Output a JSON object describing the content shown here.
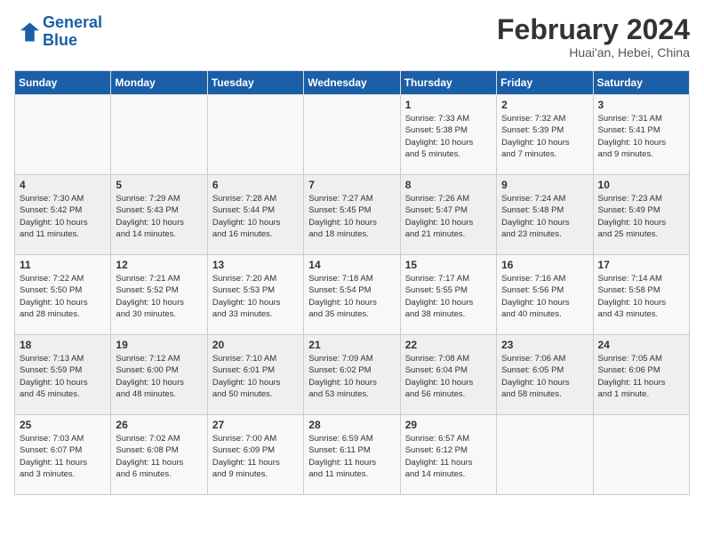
{
  "header": {
    "logo_line1": "General",
    "logo_line2": "Blue",
    "title": "February 2024",
    "subtitle": "Huai'an, Hebei, China"
  },
  "weekdays": [
    "Sunday",
    "Monday",
    "Tuesday",
    "Wednesday",
    "Thursday",
    "Friday",
    "Saturday"
  ],
  "weeks": [
    [
      {
        "day": "",
        "info": ""
      },
      {
        "day": "",
        "info": ""
      },
      {
        "day": "",
        "info": ""
      },
      {
        "day": "",
        "info": ""
      },
      {
        "day": "1",
        "info": "Sunrise: 7:33 AM\nSunset: 5:38 PM\nDaylight: 10 hours\nand 5 minutes."
      },
      {
        "day": "2",
        "info": "Sunrise: 7:32 AM\nSunset: 5:39 PM\nDaylight: 10 hours\nand 7 minutes."
      },
      {
        "day": "3",
        "info": "Sunrise: 7:31 AM\nSunset: 5:41 PM\nDaylight: 10 hours\nand 9 minutes."
      }
    ],
    [
      {
        "day": "4",
        "info": "Sunrise: 7:30 AM\nSunset: 5:42 PM\nDaylight: 10 hours\nand 11 minutes."
      },
      {
        "day": "5",
        "info": "Sunrise: 7:29 AM\nSunset: 5:43 PM\nDaylight: 10 hours\nand 14 minutes."
      },
      {
        "day": "6",
        "info": "Sunrise: 7:28 AM\nSunset: 5:44 PM\nDaylight: 10 hours\nand 16 minutes."
      },
      {
        "day": "7",
        "info": "Sunrise: 7:27 AM\nSunset: 5:45 PM\nDaylight: 10 hours\nand 18 minutes."
      },
      {
        "day": "8",
        "info": "Sunrise: 7:26 AM\nSunset: 5:47 PM\nDaylight: 10 hours\nand 21 minutes."
      },
      {
        "day": "9",
        "info": "Sunrise: 7:24 AM\nSunset: 5:48 PM\nDaylight: 10 hours\nand 23 minutes."
      },
      {
        "day": "10",
        "info": "Sunrise: 7:23 AM\nSunset: 5:49 PM\nDaylight: 10 hours\nand 25 minutes."
      }
    ],
    [
      {
        "day": "11",
        "info": "Sunrise: 7:22 AM\nSunset: 5:50 PM\nDaylight: 10 hours\nand 28 minutes."
      },
      {
        "day": "12",
        "info": "Sunrise: 7:21 AM\nSunset: 5:52 PM\nDaylight: 10 hours\nand 30 minutes."
      },
      {
        "day": "13",
        "info": "Sunrise: 7:20 AM\nSunset: 5:53 PM\nDaylight: 10 hours\nand 33 minutes."
      },
      {
        "day": "14",
        "info": "Sunrise: 7:18 AM\nSunset: 5:54 PM\nDaylight: 10 hours\nand 35 minutes."
      },
      {
        "day": "15",
        "info": "Sunrise: 7:17 AM\nSunset: 5:55 PM\nDaylight: 10 hours\nand 38 minutes."
      },
      {
        "day": "16",
        "info": "Sunrise: 7:16 AM\nSunset: 5:56 PM\nDaylight: 10 hours\nand 40 minutes."
      },
      {
        "day": "17",
        "info": "Sunrise: 7:14 AM\nSunset: 5:58 PM\nDaylight: 10 hours\nand 43 minutes."
      }
    ],
    [
      {
        "day": "18",
        "info": "Sunrise: 7:13 AM\nSunset: 5:59 PM\nDaylight: 10 hours\nand 45 minutes."
      },
      {
        "day": "19",
        "info": "Sunrise: 7:12 AM\nSunset: 6:00 PM\nDaylight: 10 hours\nand 48 minutes."
      },
      {
        "day": "20",
        "info": "Sunrise: 7:10 AM\nSunset: 6:01 PM\nDaylight: 10 hours\nand 50 minutes."
      },
      {
        "day": "21",
        "info": "Sunrise: 7:09 AM\nSunset: 6:02 PM\nDaylight: 10 hours\nand 53 minutes."
      },
      {
        "day": "22",
        "info": "Sunrise: 7:08 AM\nSunset: 6:04 PM\nDaylight: 10 hours\nand 56 minutes."
      },
      {
        "day": "23",
        "info": "Sunrise: 7:06 AM\nSunset: 6:05 PM\nDaylight: 10 hours\nand 58 minutes."
      },
      {
        "day": "24",
        "info": "Sunrise: 7:05 AM\nSunset: 6:06 PM\nDaylight: 11 hours\nand 1 minute."
      }
    ],
    [
      {
        "day": "25",
        "info": "Sunrise: 7:03 AM\nSunset: 6:07 PM\nDaylight: 11 hours\nand 3 minutes."
      },
      {
        "day": "26",
        "info": "Sunrise: 7:02 AM\nSunset: 6:08 PM\nDaylight: 11 hours\nand 6 minutes."
      },
      {
        "day": "27",
        "info": "Sunrise: 7:00 AM\nSunset: 6:09 PM\nDaylight: 11 hours\nand 9 minutes."
      },
      {
        "day": "28",
        "info": "Sunrise: 6:59 AM\nSunset: 6:11 PM\nDaylight: 11 hours\nand 11 minutes."
      },
      {
        "day": "29",
        "info": "Sunrise: 6:57 AM\nSunset: 6:12 PM\nDaylight: 11 hours\nand 14 minutes."
      },
      {
        "day": "",
        "info": ""
      },
      {
        "day": "",
        "info": ""
      }
    ]
  ]
}
